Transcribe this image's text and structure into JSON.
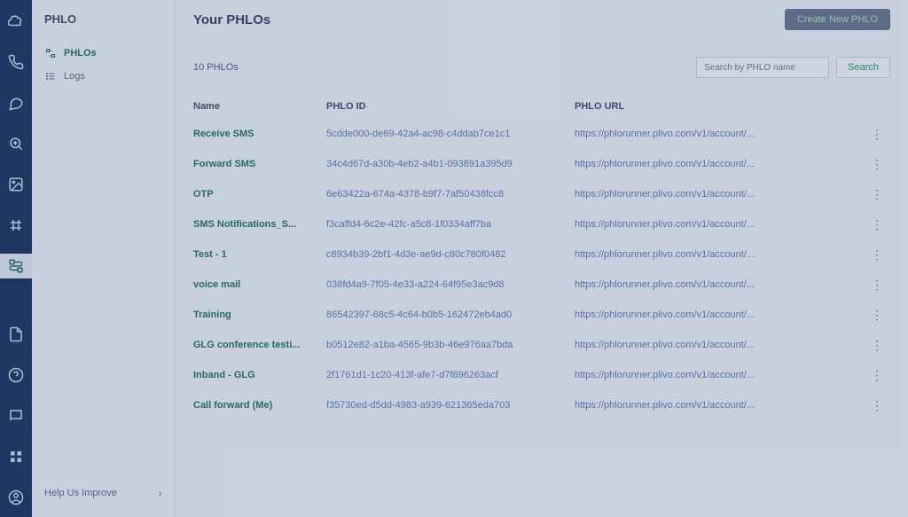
{
  "rail": {
    "items": [
      {
        "name": "cloud-icon"
      },
      {
        "name": "phone-icon"
      },
      {
        "name": "chat-icon"
      },
      {
        "name": "zoom-icon"
      },
      {
        "name": "image-icon"
      },
      {
        "name": "grid-icon"
      },
      {
        "name": "flow-icon",
        "active": true
      }
    ],
    "bottom": [
      {
        "name": "doc-icon"
      },
      {
        "name": "help-icon"
      },
      {
        "name": "message-icon"
      },
      {
        "name": "apps-icon"
      },
      {
        "name": "avatar-icon"
      }
    ]
  },
  "nav2": {
    "title": "PHLO",
    "items": [
      {
        "label": "PHLOs",
        "active": true,
        "icon": "flow"
      },
      {
        "label": "Logs",
        "active": false,
        "icon": "list"
      }
    ],
    "help": "Help Us Improve"
  },
  "main": {
    "title": "Your PHLOs",
    "create_label": "Create New PHLO",
    "count": "10 PHLOs",
    "search_placeholder": "Search by PHLO name",
    "search_btn": "Search",
    "columns": {
      "name": "Name",
      "id": "PHLO ID",
      "url": "PHLO URL"
    },
    "rows": [
      {
        "name": "Receive SMS",
        "id": "5cdde000-de69-42a4-ac98-c4ddab7ce1c1",
        "url": "https://phlorunner.plivo.com/v1/account/..."
      },
      {
        "name": "Forward SMS",
        "id": "34c4d67d-a30b-4eb2-a4b1-093891a395d9",
        "url": "https://phlorunner.plivo.com/v1/account/..."
      },
      {
        "name": "OTP",
        "id": "6e63422a-674a-4378-b9f7-7af50438fcc8",
        "url": "https://phlorunner.plivo.com/v1/account/..."
      },
      {
        "name": "SMS Notifications_S...",
        "id": "f3caffd4-6c2e-42fc-a5c8-1f0334aff7ba",
        "url": "https://phlorunner.plivo.com/v1/account/..."
      },
      {
        "name": "Test - 1",
        "id": "c8934b39-2bf1-4d3e-ae9d-c80c780f0482",
        "url": "https://phlorunner.plivo.com/v1/account/..."
      },
      {
        "name": "voice mail",
        "id": "038fd4a9-7f05-4e33-a224-64f95e3ac9d8",
        "url": "https://phlorunner.plivo.com/v1/account/..."
      },
      {
        "name": "Training",
        "id": "86542397-68c5-4c64-b0b5-162472eb4ad0",
        "url": "https://phlorunner.plivo.com/v1/account/..."
      },
      {
        "name": "GLG conference testi...",
        "id": "b0512e82-a1ba-4565-9b3b-46e976aa7bda",
        "url": "https://phlorunner.plivo.com/v1/account/..."
      },
      {
        "name": "Inband - GLG",
        "id": "2f1761d1-1c20-413f-afe7-d7f896263acf",
        "url": "https://phlorunner.plivo.com/v1/account/..."
      },
      {
        "name": "Call forward (Me)",
        "id": "f35730ed-d5dd-4983-a939-621365eda703",
        "url": "https://phlorunner.plivo.com/v1/account/..."
      }
    ]
  }
}
